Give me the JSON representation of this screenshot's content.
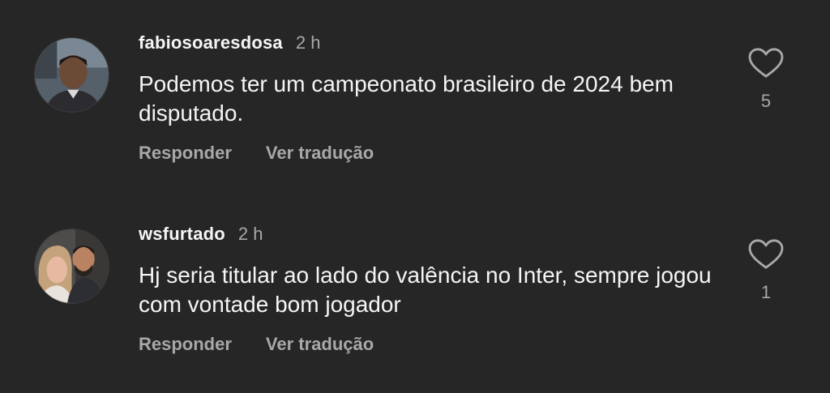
{
  "comments": [
    {
      "username": "fabiosoaresdosa",
      "time": "2 h",
      "text": "Podemos ter um campeonato brasileiro de 2024 bem disputado.",
      "reply_label": "Responder",
      "translate_label": "Ver tradução",
      "like_count": "5",
      "like_icon": "heart-outline-icon"
    },
    {
      "username": "wsfurtado",
      "time": "2 h",
      "text": "Hj seria titular ao lado do valência no Inter, sempre jogou com vontade bom jogador",
      "reply_label": "Responder",
      "translate_label": "Ver tradução",
      "like_count": "1",
      "like_icon": "heart-outline-icon"
    }
  ],
  "colors": {
    "background": "#262626",
    "primary_text": "#f5f5f5",
    "secondary_text": "#a8a8a8"
  }
}
